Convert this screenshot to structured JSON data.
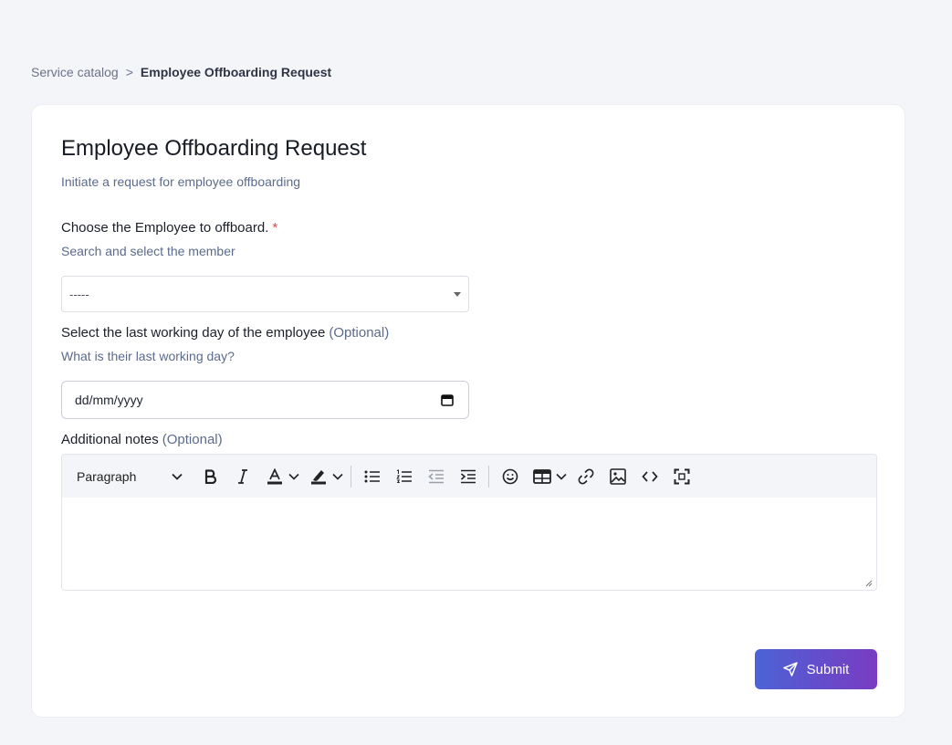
{
  "breadcrumb": {
    "parent": "Service catalog",
    "separator": ">",
    "current": "Employee Offboarding Request"
  },
  "form": {
    "title": "Employee Offboarding Request",
    "subtitle": "Initiate a request for employee offboarding",
    "employee_field": {
      "label": "Choose the Employee to offboard.",
      "required_mark": "*",
      "help": "Search and select the member",
      "value": "-----"
    },
    "last_day_field": {
      "label": "Select the last working day of the employee",
      "optional": "(Optional)",
      "help": "What is their last working day?",
      "placeholder": "dd/mm/yyyy"
    },
    "notes_field": {
      "label": "Additional notes",
      "optional": "(Optional)",
      "toolbar": {
        "block_format": "Paragraph",
        "icons": [
          "bold-icon",
          "italic-icon",
          "text-color-icon",
          "highlight-icon",
          "bullet-list-icon",
          "numbered-list-icon",
          "outdent-icon",
          "indent-icon",
          "emoji-icon",
          "table-icon",
          "link-icon",
          "image-icon",
          "code-icon",
          "fullscreen-icon"
        ]
      }
    },
    "submit_label": "Submit"
  },
  "colors": {
    "background": "#f4f5f8",
    "required": "#e5484d",
    "muted_text": "#5b6b8c",
    "submit_gradient_start": "#4b63d6",
    "submit_gradient_end": "#7a3bc2"
  }
}
